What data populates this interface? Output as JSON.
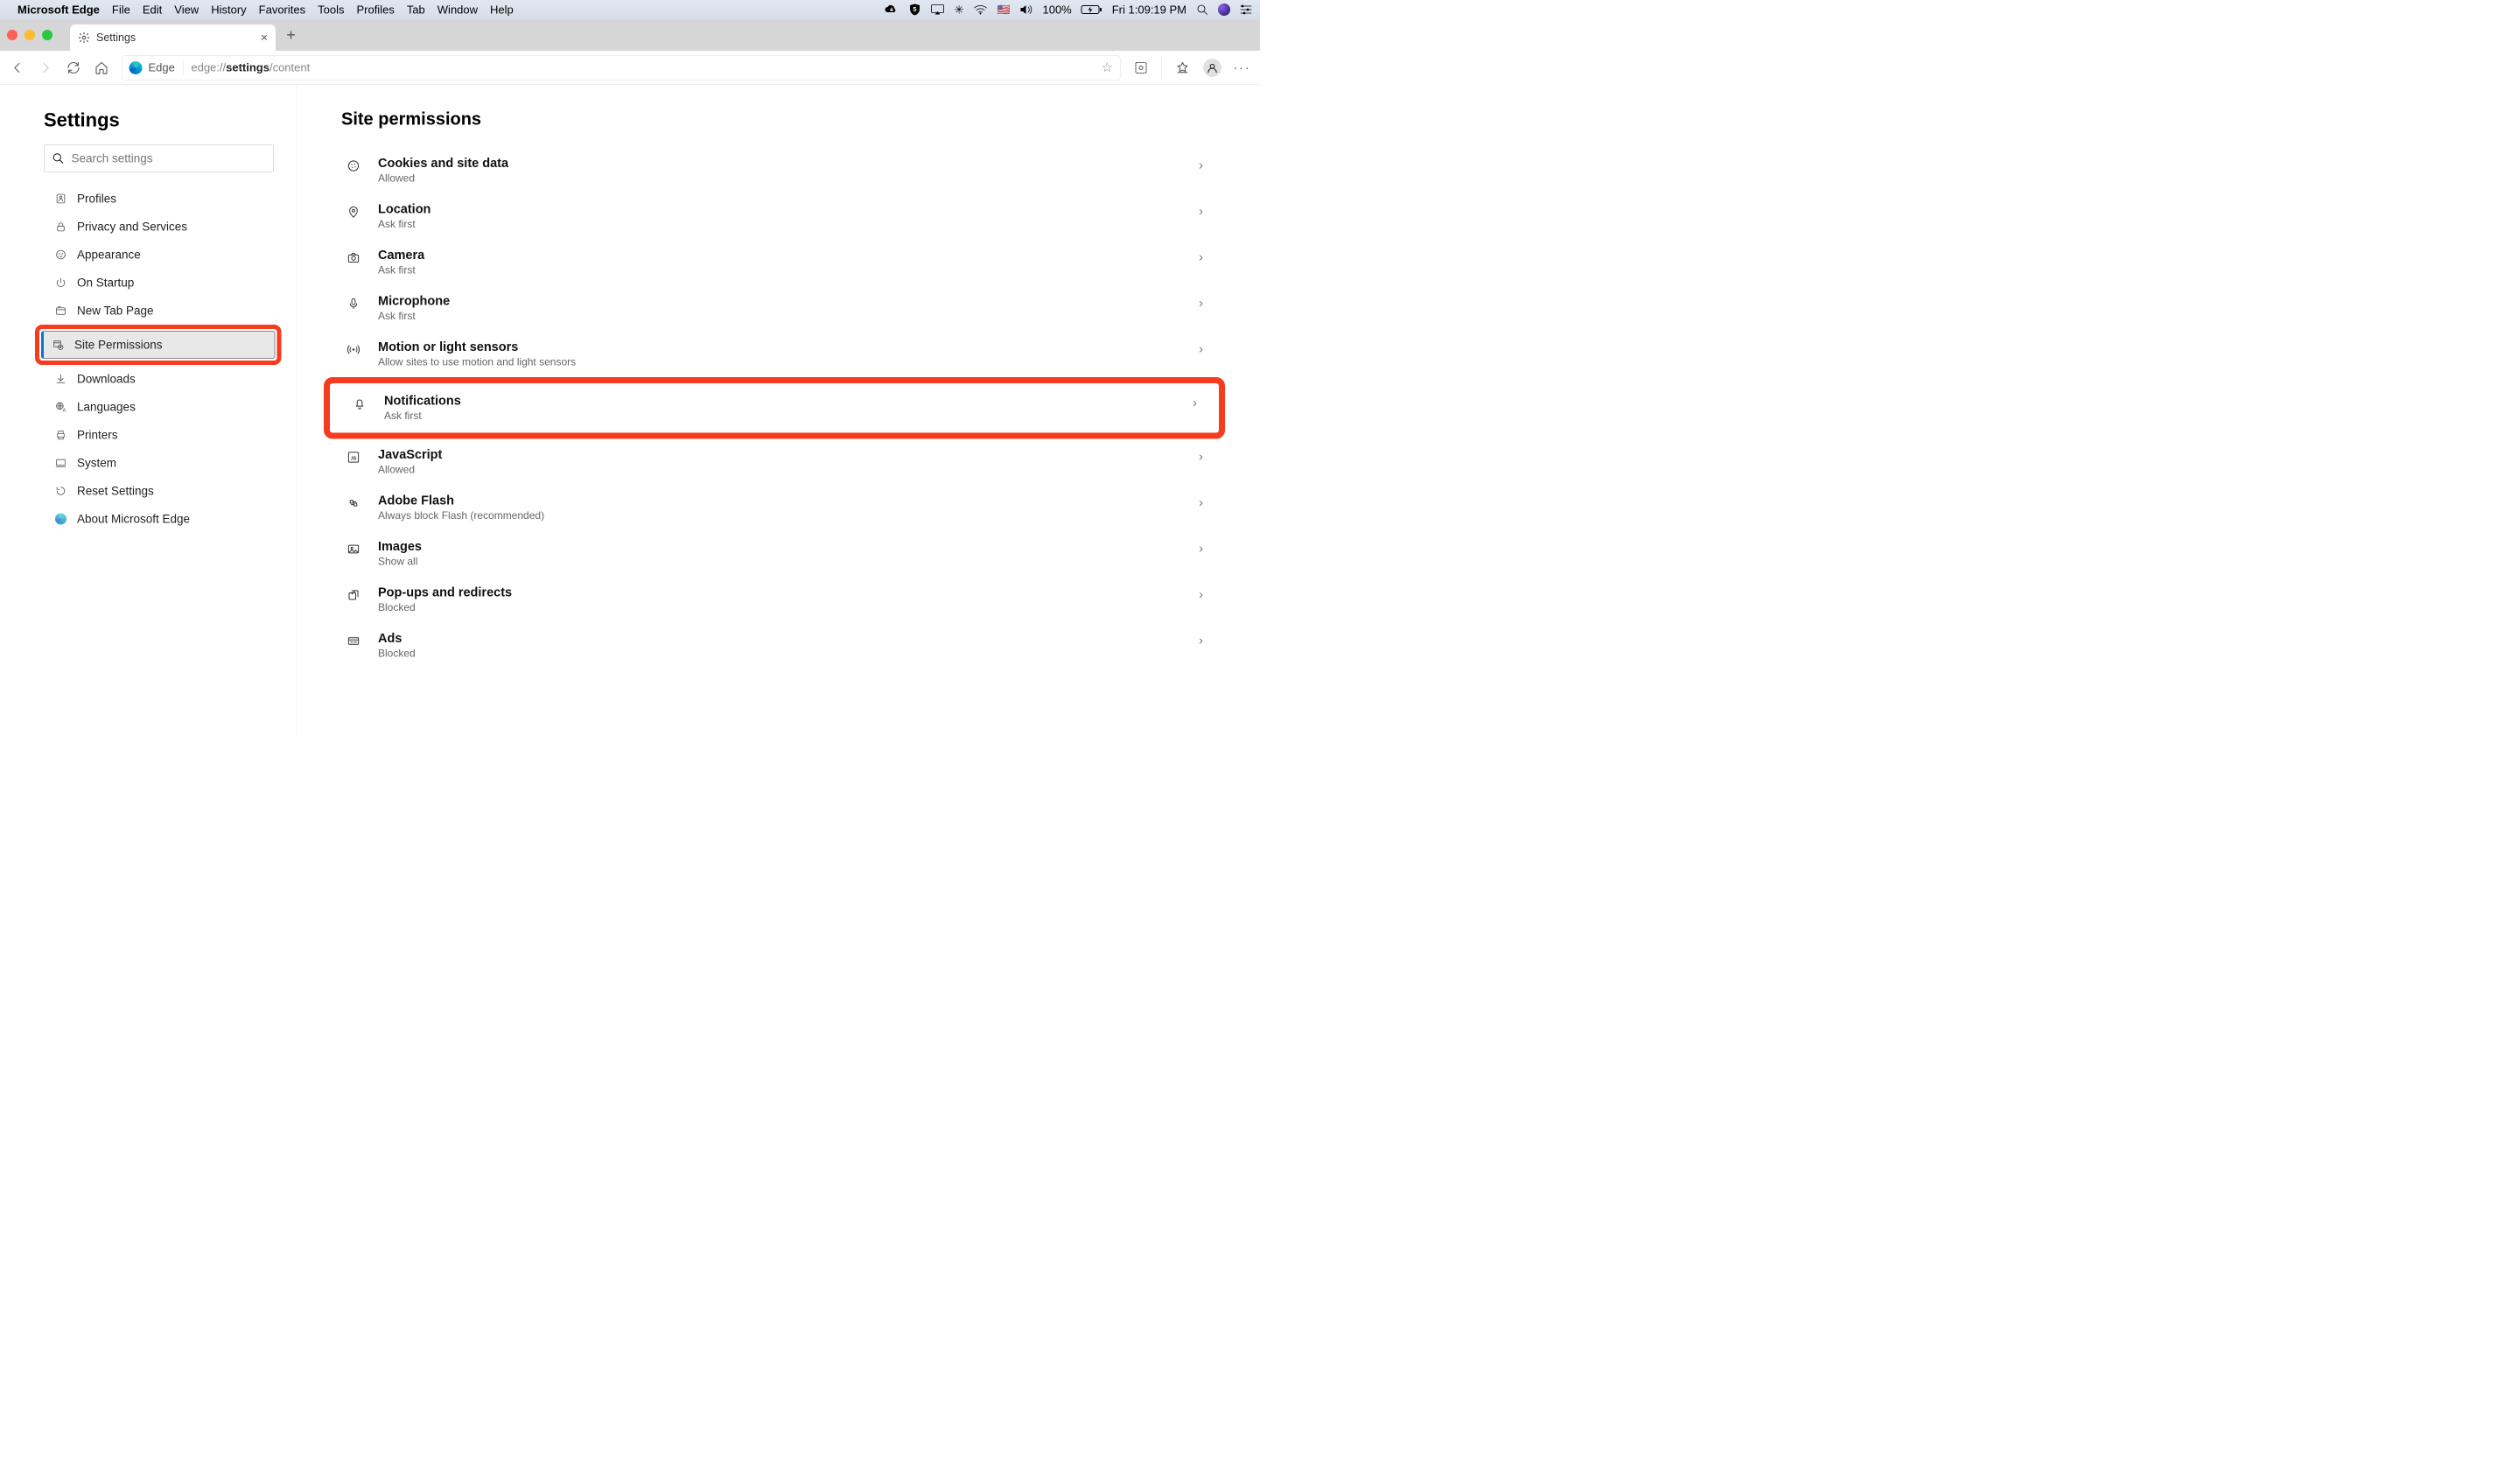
{
  "menubar": {
    "app_name": "Microsoft Edge",
    "items": [
      "File",
      "Edit",
      "View",
      "History",
      "Favorites",
      "Tools",
      "Profiles",
      "Tab",
      "Window",
      "Help"
    ],
    "battery_pct": "100%",
    "clock": "Fri 1:09:19 PM"
  },
  "tab": {
    "title": "Settings"
  },
  "omnibox": {
    "label": "Edge",
    "url_prefix": "edge://",
    "url_bold": "settings",
    "url_suffix": "/content"
  },
  "sidebar": {
    "title": "Settings",
    "search_placeholder": "Search settings",
    "items": [
      {
        "label": "Profiles",
        "icon": "profile"
      },
      {
        "label": "Privacy and Services",
        "icon": "lock"
      },
      {
        "label": "Appearance",
        "icon": "appearance"
      },
      {
        "label": "On Startup",
        "icon": "power"
      },
      {
        "label": "New Tab Page",
        "icon": "newtab"
      },
      {
        "label": "Site Permissions",
        "icon": "sitepermissions",
        "selected": true,
        "highlighted": true
      },
      {
        "label": "Downloads",
        "icon": "download"
      },
      {
        "label": "Languages",
        "icon": "language"
      },
      {
        "label": "Printers",
        "icon": "printer"
      },
      {
        "label": "System",
        "icon": "system"
      },
      {
        "label": "Reset Settings",
        "icon": "reset"
      },
      {
        "label": "About Microsoft Edge",
        "icon": "edge"
      }
    ]
  },
  "main": {
    "heading": "Site permissions",
    "rows": [
      {
        "title": "Cookies and site data",
        "sub": "Allowed",
        "icon": "cookie"
      },
      {
        "title": "Location",
        "sub": "Ask first",
        "icon": "location"
      },
      {
        "title": "Camera",
        "sub": "Ask first",
        "icon": "camera"
      },
      {
        "title": "Microphone",
        "sub": "Ask first",
        "icon": "mic"
      },
      {
        "title": "Motion or light sensors",
        "sub": "Allow sites to use motion and light sensors",
        "icon": "motion"
      },
      {
        "title": "Notifications",
        "sub": "Ask first",
        "icon": "bell",
        "highlighted": true
      },
      {
        "title": "JavaScript",
        "sub": "Allowed",
        "icon": "js"
      },
      {
        "title": "Adobe Flash",
        "sub": "Always block Flash (recommended)",
        "icon": "flash"
      },
      {
        "title": "Images",
        "sub": "Show all",
        "icon": "image"
      },
      {
        "title": "Pop-ups and redirects",
        "sub": "Blocked",
        "icon": "popup"
      },
      {
        "title": "Ads",
        "sub": "Blocked",
        "icon": "ads"
      }
    ]
  }
}
